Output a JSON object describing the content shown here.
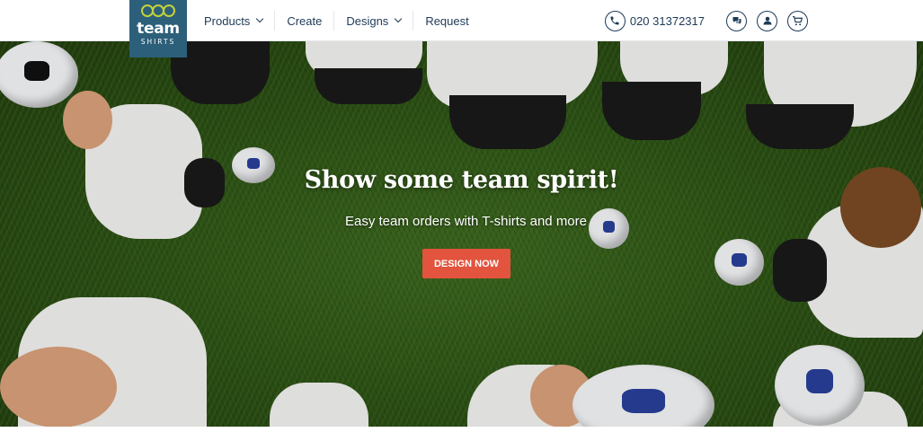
{
  "logo": {
    "word": "team",
    "sub": "SHIRTS"
  },
  "nav": {
    "items": [
      {
        "label": "Products",
        "dropdown": true
      },
      {
        "label": "Create",
        "dropdown": false
      },
      {
        "label": "Designs",
        "dropdown": true
      },
      {
        "label": "Request",
        "dropdown": false
      }
    ]
  },
  "tools": {
    "phone": "020 31372317",
    "icons": [
      "phone-icon",
      "chat-icon",
      "user-icon",
      "cart-icon"
    ]
  },
  "hero": {
    "title": "Show some team spirit!",
    "subtitle": "Easy team orders with T-shirts and more",
    "cta_label": "DESIGN NOW"
  },
  "colors": {
    "brand": "#2c5f7a",
    "accent_lime": "#c3d13a",
    "text": "#1d3a57",
    "cta": "#e2543d"
  }
}
